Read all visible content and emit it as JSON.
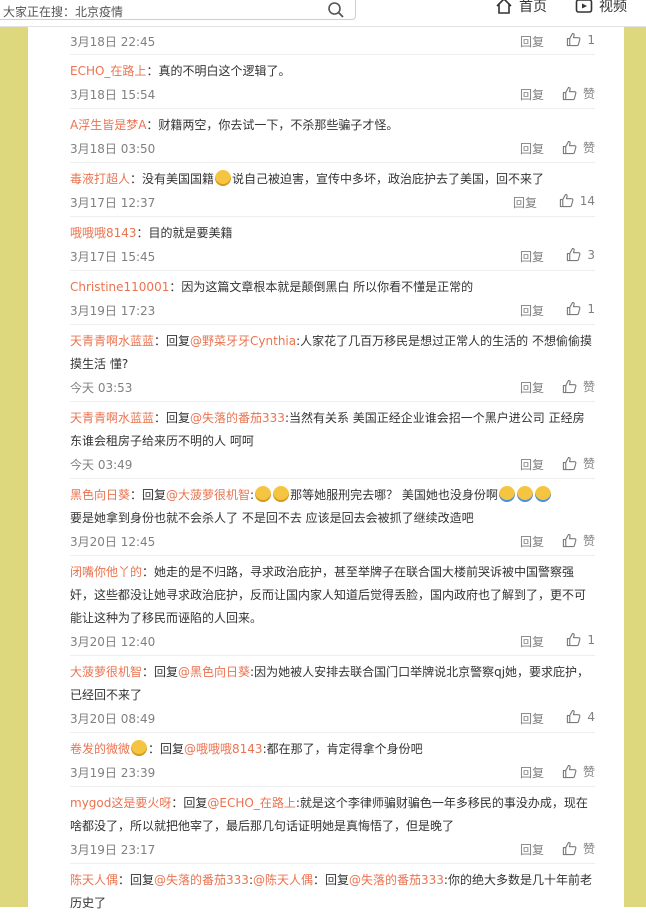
{
  "topbar": {
    "search_placeholder": "大家正在搜：北京疫情",
    "nav_home": "首页",
    "nav_video": "视频"
  },
  "labels": {
    "reply": "回复"
  },
  "comments": [
    {
      "user": "",
      "text": "",
      "time": "3月18日 22:45",
      "likes": "1"
    },
    {
      "user": "ECHO_在路上",
      "text": "：真的不明白这个逻辑了。",
      "time": "3月18日 15:54",
      "likes": "赞"
    },
    {
      "user": "A浮生皆是梦A",
      "text": "：财籍两空，你去试一下，不杀那些骗子才怪。",
      "time": "3月18日 03:50",
      "likes": "赞"
    },
    {
      "user": "毒液打超人",
      "text_a": "：没有美国国籍",
      "text_b": "说自己被迫害，宣传中多坏，政治庇护去了美国，回不来了",
      "time": "3月17日 12:37",
      "likes": "14"
    },
    {
      "user": "哦哦哦8143",
      "text": "：目的就是要美籍",
      "time": "3月17日 15:45",
      "likes": "3"
    },
    {
      "user": "Christine110001",
      "text": "：因为这篇文章根本就是颠倒黑白 所以你看不懂是正常的",
      "time": "3月19日 17:23",
      "likes": "1"
    },
    {
      "user": "天青青啊水蓝蓝",
      "prefix": "：回复",
      "mention": "@野菜牙牙Cynthia",
      "text": ":人家花了几百万移民是想过正常人的生活的 不想偷偷摸摸生活 懂?",
      "time": "今天 03:53",
      "likes": "赞"
    },
    {
      "user": "天青青啊水蓝蓝",
      "prefix": "：回复",
      "mention": "@失落的番茄333",
      "text": ":当然有关系 美国正经企业谁会招一个黑户进公司 正经房东谁会租房子给来历不明的人 呵呵",
      "time": "今天 03:49",
      "likes": "赞"
    },
    {
      "user": "黑色向日葵",
      "prefix": "：回复",
      "mention": "@大菠萝很机智",
      "text_a": ":",
      "text_b": "那等她服刑完去哪？  美国她也没身份啊",
      "text_c": "要是她拿到身份也就不会杀人了 不是回不去 应该是回去会被抓了继续改造吧",
      "time": "3月20日 12:45",
      "likes": "赞"
    },
    {
      "user": "闭嘴你他丫的",
      "text": "：她走的是不归路，寻求政治庇护，甚至举牌子在联合国大楼前哭诉被中国警察强奸，这些都没让她寻求政治庇护，反而让国内家人知道后觉得丢脸，国内政府也了解到了，更不可能让这种为了移民而诬陷的人回来。",
      "time": "3月20日 12:40",
      "likes": "1"
    },
    {
      "user": "大菠萝很机智",
      "prefix": "：回复",
      "mention": "@黑色向日葵",
      "text": ":因为她被人安排去联合国门口举牌说北京警察qj她，要求庇护，已经回不来了",
      "time": "3月20日 08:49",
      "likes": "4"
    },
    {
      "user": "卷发的微微",
      "prefix": "：回复",
      "mention": "@哦哦哦8143",
      "text": ":都在那了，肯定得拿个身份吧",
      "time": "3月19日 23:39",
      "likes": "赞"
    },
    {
      "user": "mygod这是要火呀",
      "prefix": "：回复",
      "mention": "@ECHO_在路上",
      "text": ":就是这个李律师骗财骗色一年多移民的事没办成，现在啥都没了，所以就把他宰了，最后那几句话证明她是真悔悟了，但是晚了",
      "time": "3月19日 23:17",
      "likes": "赞"
    },
    {
      "user": "陈天人偶",
      "prefix": "：回复",
      "mention": "@失落的番茄333",
      "mid": ":",
      "mention2": "@陈天人偶",
      "mid2": "：回复",
      "mention3": "@失落的番茄333",
      "text": ":你的绝大多数是几十年前老历史了",
      "time": "",
      "likes": ""
    }
  ]
}
